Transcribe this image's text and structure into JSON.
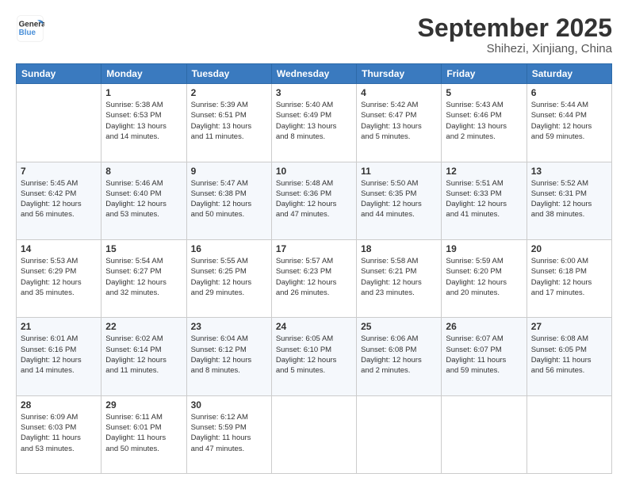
{
  "logo": {
    "general": "General",
    "blue": "Blue"
  },
  "title": "September 2025",
  "subtitle": "Shihezi, Xinjiang, China",
  "header": {
    "days": [
      "Sunday",
      "Monday",
      "Tuesday",
      "Wednesday",
      "Thursday",
      "Friday",
      "Saturday"
    ]
  },
  "weeks": [
    [
      {
        "day": "",
        "info": ""
      },
      {
        "day": "1",
        "info": "Sunrise: 5:38 AM\nSunset: 6:53 PM\nDaylight: 13 hours\nand 14 minutes."
      },
      {
        "day": "2",
        "info": "Sunrise: 5:39 AM\nSunset: 6:51 PM\nDaylight: 13 hours\nand 11 minutes."
      },
      {
        "day": "3",
        "info": "Sunrise: 5:40 AM\nSunset: 6:49 PM\nDaylight: 13 hours\nand 8 minutes."
      },
      {
        "day": "4",
        "info": "Sunrise: 5:42 AM\nSunset: 6:47 PM\nDaylight: 13 hours\nand 5 minutes."
      },
      {
        "day": "5",
        "info": "Sunrise: 5:43 AM\nSunset: 6:46 PM\nDaylight: 13 hours\nand 2 minutes."
      },
      {
        "day": "6",
        "info": "Sunrise: 5:44 AM\nSunset: 6:44 PM\nDaylight: 12 hours\nand 59 minutes."
      }
    ],
    [
      {
        "day": "7",
        "info": "Sunrise: 5:45 AM\nSunset: 6:42 PM\nDaylight: 12 hours\nand 56 minutes."
      },
      {
        "day": "8",
        "info": "Sunrise: 5:46 AM\nSunset: 6:40 PM\nDaylight: 12 hours\nand 53 minutes."
      },
      {
        "day": "9",
        "info": "Sunrise: 5:47 AM\nSunset: 6:38 PM\nDaylight: 12 hours\nand 50 minutes."
      },
      {
        "day": "10",
        "info": "Sunrise: 5:48 AM\nSunset: 6:36 PM\nDaylight: 12 hours\nand 47 minutes."
      },
      {
        "day": "11",
        "info": "Sunrise: 5:50 AM\nSunset: 6:35 PM\nDaylight: 12 hours\nand 44 minutes."
      },
      {
        "day": "12",
        "info": "Sunrise: 5:51 AM\nSunset: 6:33 PM\nDaylight: 12 hours\nand 41 minutes."
      },
      {
        "day": "13",
        "info": "Sunrise: 5:52 AM\nSunset: 6:31 PM\nDaylight: 12 hours\nand 38 minutes."
      }
    ],
    [
      {
        "day": "14",
        "info": "Sunrise: 5:53 AM\nSunset: 6:29 PM\nDaylight: 12 hours\nand 35 minutes."
      },
      {
        "day": "15",
        "info": "Sunrise: 5:54 AM\nSunset: 6:27 PM\nDaylight: 12 hours\nand 32 minutes."
      },
      {
        "day": "16",
        "info": "Sunrise: 5:55 AM\nSunset: 6:25 PM\nDaylight: 12 hours\nand 29 minutes."
      },
      {
        "day": "17",
        "info": "Sunrise: 5:57 AM\nSunset: 6:23 PM\nDaylight: 12 hours\nand 26 minutes."
      },
      {
        "day": "18",
        "info": "Sunrise: 5:58 AM\nSunset: 6:21 PM\nDaylight: 12 hours\nand 23 minutes."
      },
      {
        "day": "19",
        "info": "Sunrise: 5:59 AM\nSunset: 6:20 PM\nDaylight: 12 hours\nand 20 minutes."
      },
      {
        "day": "20",
        "info": "Sunrise: 6:00 AM\nSunset: 6:18 PM\nDaylight: 12 hours\nand 17 minutes."
      }
    ],
    [
      {
        "day": "21",
        "info": "Sunrise: 6:01 AM\nSunset: 6:16 PM\nDaylight: 12 hours\nand 14 minutes."
      },
      {
        "day": "22",
        "info": "Sunrise: 6:02 AM\nSunset: 6:14 PM\nDaylight: 12 hours\nand 11 minutes."
      },
      {
        "day": "23",
        "info": "Sunrise: 6:04 AM\nSunset: 6:12 PM\nDaylight: 12 hours\nand 8 minutes."
      },
      {
        "day": "24",
        "info": "Sunrise: 6:05 AM\nSunset: 6:10 PM\nDaylight: 12 hours\nand 5 minutes."
      },
      {
        "day": "25",
        "info": "Sunrise: 6:06 AM\nSunset: 6:08 PM\nDaylight: 12 hours\nand 2 minutes."
      },
      {
        "day": "26",
        "info": "Sunrise: 6:07 AM\nSunset: 6:07 PM\nDaylight: 11 hours\nand 59 minutes."
      },
      {
        "day": "27",
        "info": "Sunrise: 6:08 AM\nSunset: 6:05 PM\nDaylight: 11 hours\nand 56 minutes."
      }
    ],
    [
      {
        "day": "28",
        "info": "Sunrise: 6:09 AM\nSunset: 6:03 PM\nDaylight: 11 hours\nand 53 minutes."
      },
      {
        "day": "29",
        "info": "Sunrise: 6:11 AM\nSunset: 6:01 PM\nDaylight: 11 hours\nand 50 minutes."
      },
      {
        "day": "30",
        "info": "Sunrise: 6:12 AM\nSunset: 5:59 PM\nDaylight: 11 hours\nand 47 minutes."
      },
      {
        "day": "",
        "info": ""
      },
      {
        "day": "",
        "info": ""
      },
      {
        "day": "",
        "info": ""
      },
      {
        "day": "",
        "info": ""
      }
    ]
  ]
}
